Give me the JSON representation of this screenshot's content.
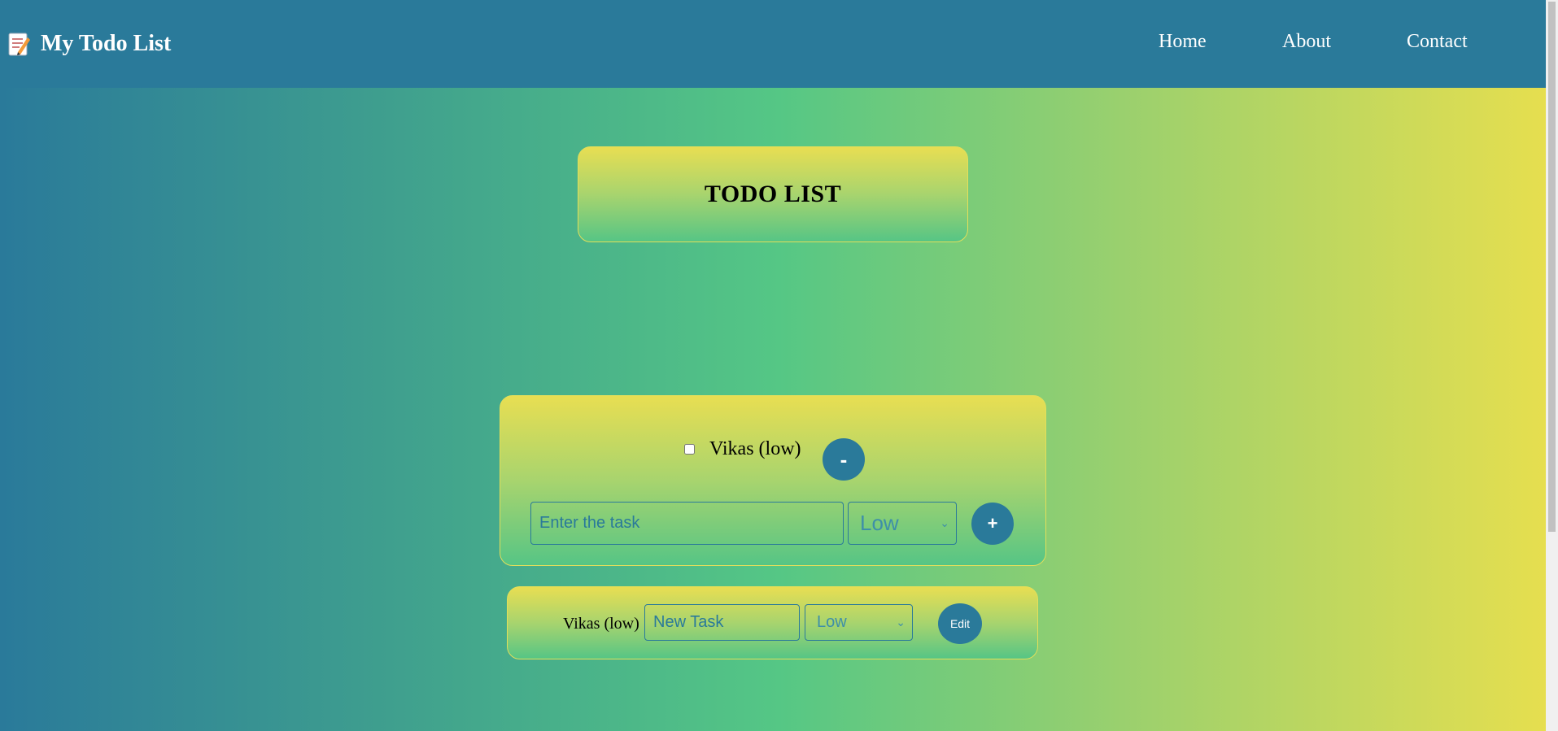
{
  "navbar": {
    "brand_title": "My Todo List",
    "links": {
      "home": "Home",
      "about": "About",
      "contact": "Contact"
    }
  },
  "title_card": {
    "title": "TODO LIST"
  },
  "task_card": {
    "task_label": "Vikas (low)",
    "remove_label": "-",
    "input_placeholder": "Enter the task",
    "priority_selected": "Low",
    "add_label": "+"
  },
  "edit_card": {
    "task_label": "Vikas (low)",
    "input_placeholder": "New Task",
    "priority_selected": "Low",
    "edit_label": "Edit"
  },
  "colors": {
    "primary": "#2a7a9a",
    "card_top": "#e8de52",
    "card_bottom": "#56c585"
  }
}
